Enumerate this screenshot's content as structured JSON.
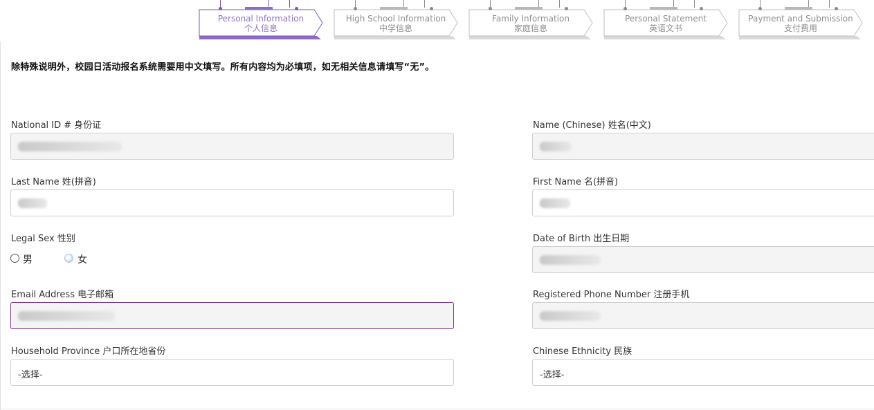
{
  "stepper": [
    {
      "en": "Personal Information",
      "cn": "个人信息",
      "state": "active"
    },
    {
      "en": "High School Information",
      "cn": "中学信息",
      "state": "inactive"
    },
    {
      "en": "Family Information",
      "cn": "家庭信息",
      "state": "inactive"
    },
    {
      "en": "Personal Statement",
      "cn": "英语文书",
      "state": "inactive"
    },
    {
      "en": "Payment and Submission",
      "cn": "支付费用",
      "state": "inactive"
    }
  ],
  "notice": "除特殊说明外，校园日活动报名系统需要用中文填写。所有内容均为必填项，如无相关信息请填写“无”。",
  "form": {
    "national_id_label": "National ID #  身份证",
    "name_cn_label": "Name (Chinese)  姓名(中文)",
    "last_name_label": "Last  Name  姓(拼音)",
    "first_name_label": "First Name  名(拼音)",
    "legal_sex_label": "Legal Sex  性别",
    "sex_options": [
      {
        "label": "男",
        "checked": false
      },
      {
        "label": "女",
        "checked": true
      }
    ],
    "dob_label": "Date of Birth  出生日期",
    "email_label": "Email Address  电子邮箱",
    "phone_label": "Registered Phone Number  注册手机",
    "province_label": "Household Province  户口所在地省份",
    "province_value": "-选择-",
    "ethnicity_label": "Chinese Ethnicity  民族",
    "ethnicity_value": "-选择-"
  },
  "colors": {
    "accent": "#8e6cc6",
    "accent_text": "#9274c5",
    "focus_border": "#7b3a8c",
    "inactive_text": "#8e8e8e"
  }
}
